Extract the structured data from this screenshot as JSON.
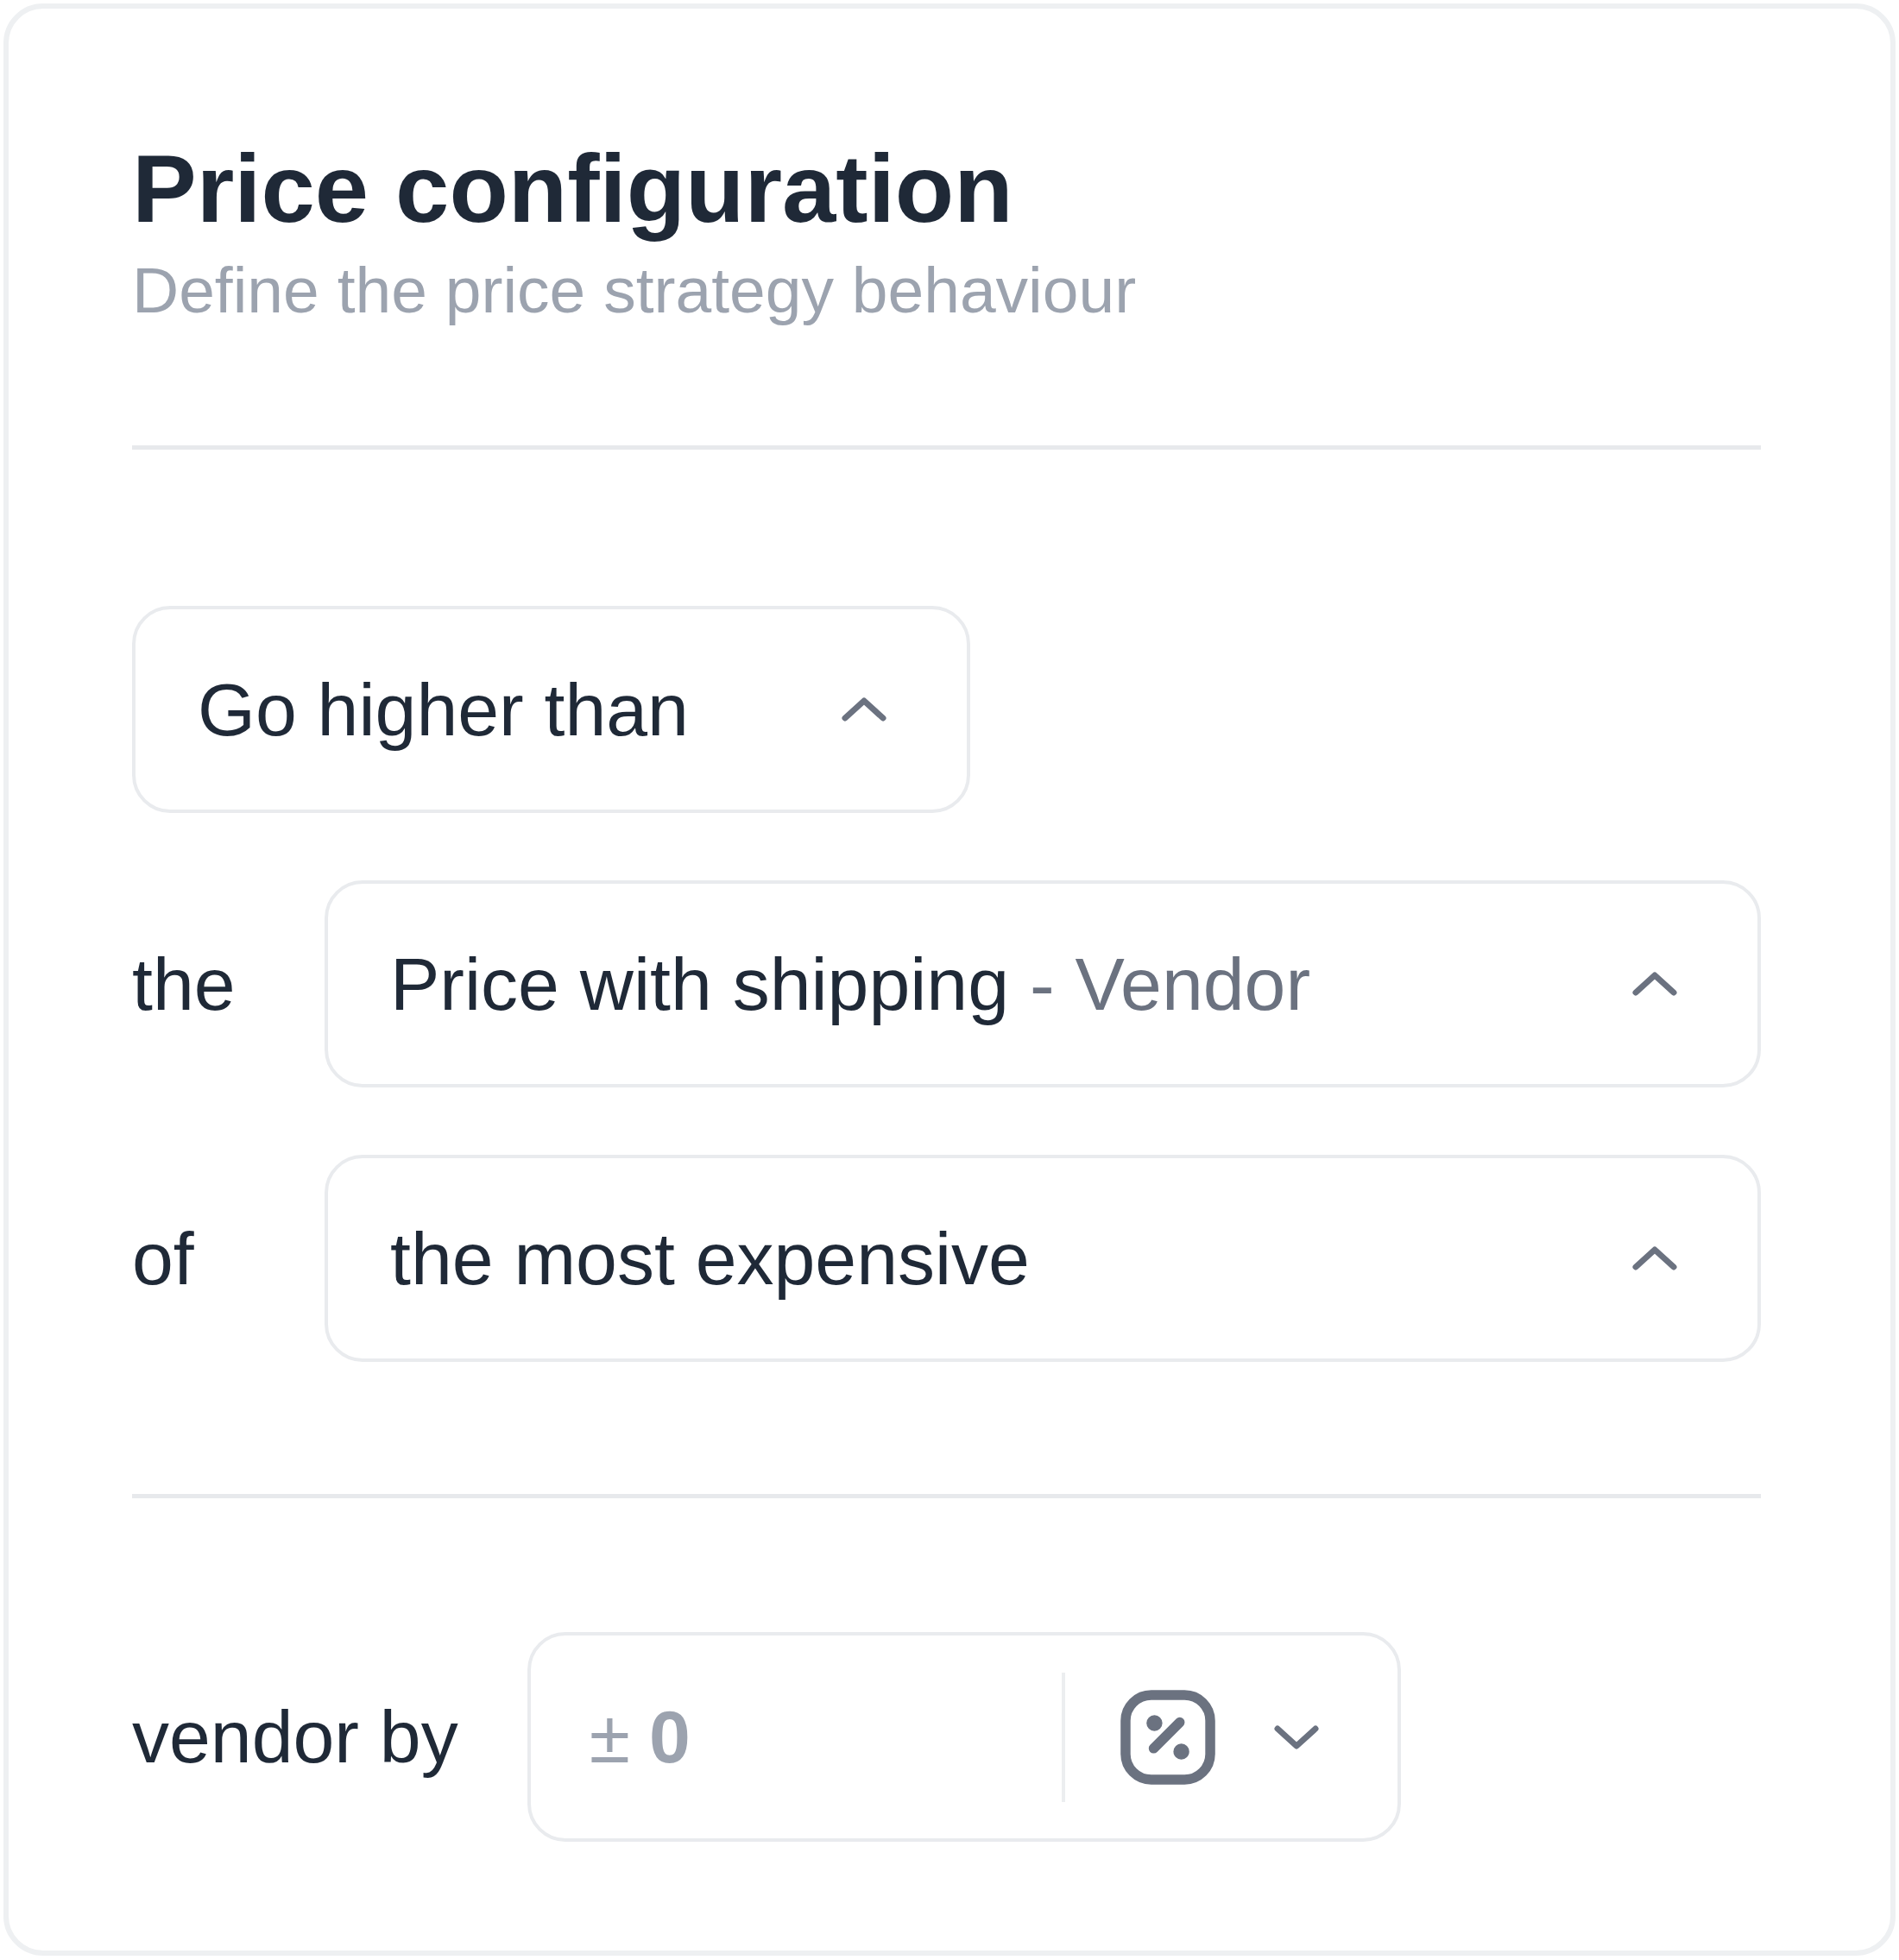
{
  "header": {
    "title": "Price configuration",
    "subtitle": "Define the price strategy behaviour"
  },
  "strategy_select": {
    "value": "Go higher than"
  },
  "rows": [
    {
      "label": "the",
      "select": {
        "value": "Price with shipping",
        "qualifier": "- Vendor"
      }
    },
    {
      "label": "of",
      "select": {
        "value": "the most expensive"
      }
    }
  ],
  "adjustment": {
    "label": "vendor by",
    "prefix": "±",
    "placeholder": "0"
  }
}
